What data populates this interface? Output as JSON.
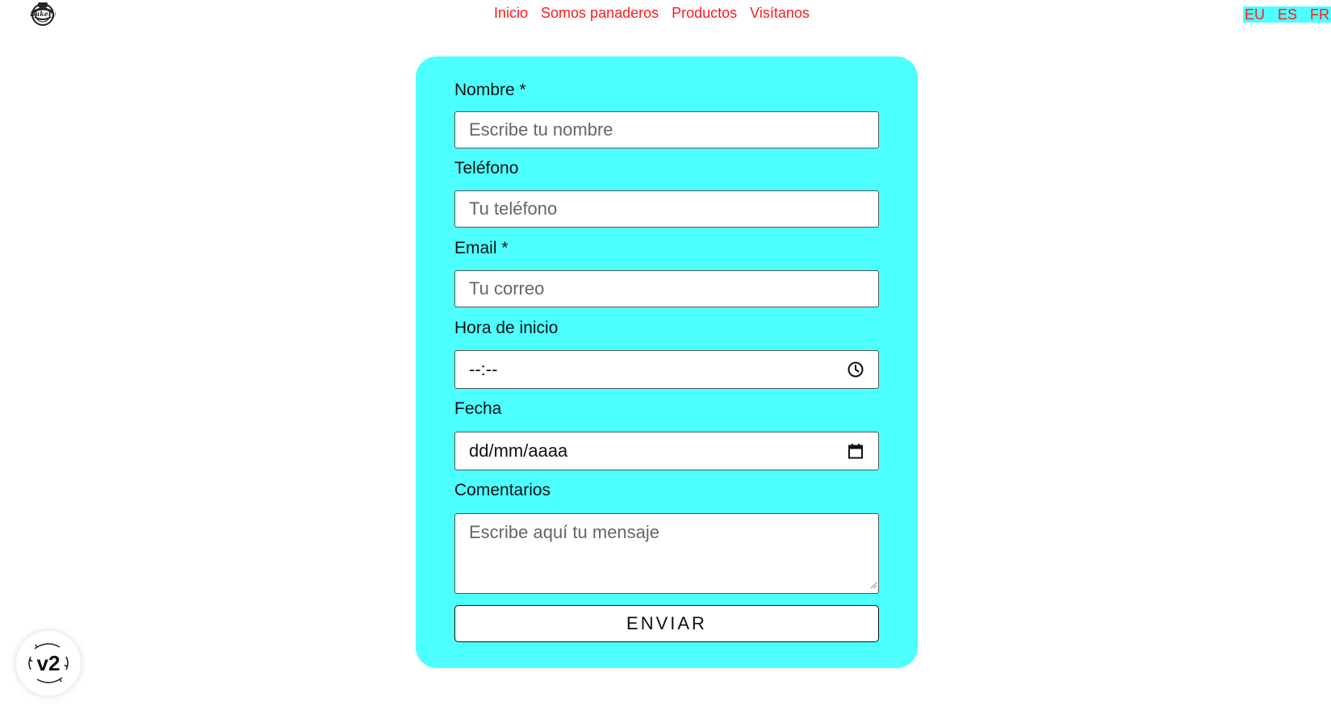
{
  "header": {
    "logo_text": "Bakery",
    "nav": [
      "Inicio",
      "Somos panaderos",
      "Productos",
      "Visítanos"
    ],
    "languages": [
      "EU",
      "ES",
      "FR"
    ]
  },
  "form": {
    "name": {
      "label": "Nombre *",
      "placeholder": "Escribe tu nombre"
    },
    "phone": {
      "label": "Teléfono",
      "placeholder": "Tu teléfono"
    },
    "email": {
      "label": "Email *",
      "placeholder": "Tu correo"
    },
    "time": {
      "label": "Hora de inicio",
      "value": "--:--"
    },
    "date": {
      "label": "Fecha",
      "value": "dd/mm/aaaa"
    },
    "comments": {
      "label": "Comentarios",
      "placeholder": "Escribe aquí tu mensaje"
    },
    "submit_label": "ENVIAR"
  },
  "badge": {
    "label": "v2"
  },
  "colors": {
    "card": "#4dffff",
    "nav_link": "#ff1a1a",
    "background": "#ffffff"
  }
}
